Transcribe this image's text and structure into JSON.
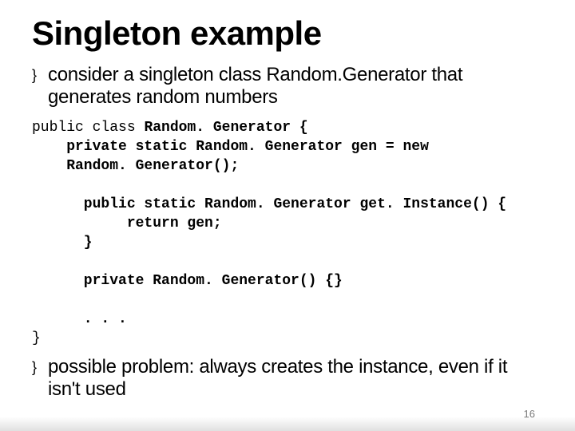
{
  "title": "Singleton example",
  "bullets": [
    "consider a singleton class Random.Generator that generates random numbers",
    "possible problem: always creates the instance, even if it isn't used"
  ],
  "code": {
    "l1a": "public class ",
    "l1b": "Random. Generator {",
    "l2": "    private static Random. Generator gen = new",
    "l3": "    Random. Generator();",
    "l4": "      public static Random. Generator get. Instance() {",
    "l5": "           return gen;",
    "l6": "      }",
    "l7": "      private Random. Generator() {}",
    "l8": "      . . .",
    "l9": "}"
  },
  "bullet_glyph": "}",
  "page_number": "16"
}
